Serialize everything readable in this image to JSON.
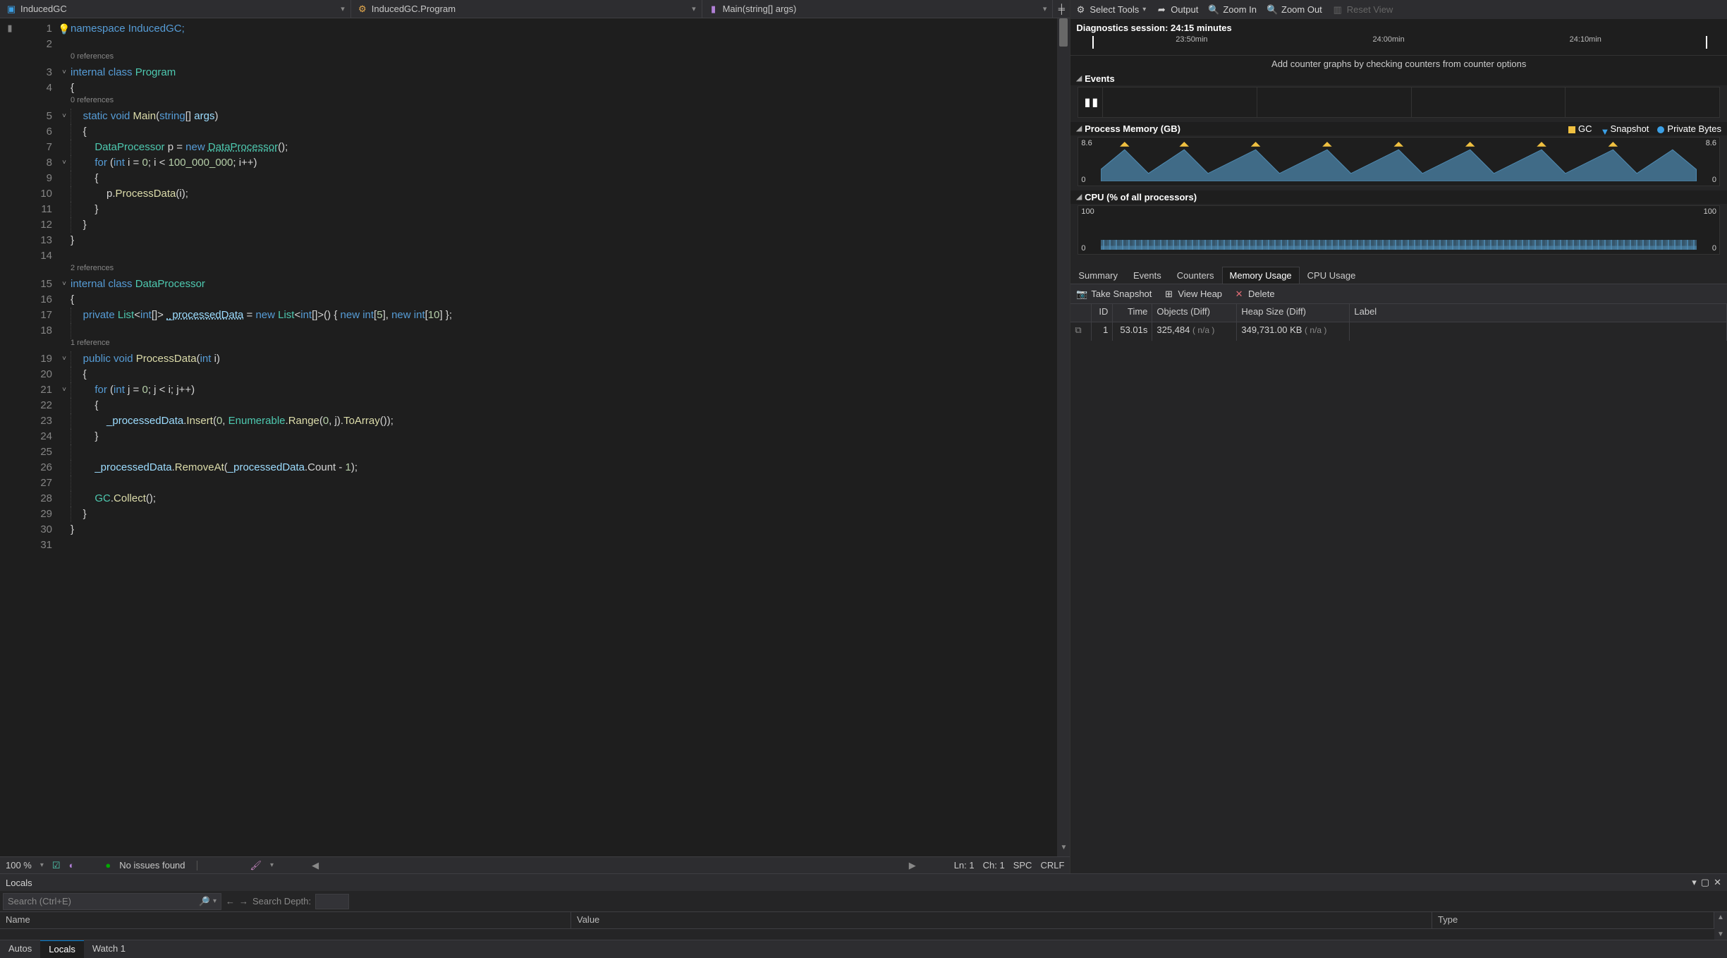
{
  "nav": {
    "project": "InducedGC",
    "class": "InducedGC.Program",
    "member": "Main(string[] args)"
  },
  "code": {
    "l1": "namespace InducedGC;",
    "ref1": "0 references",
    "l3_kw": "internal class ",
    "l3_cls": "Program",
    "ref2": "0 references",
    "l5_a": "static void ",
    "l5_m": "Main",
    "l5_b": "(",
    "l5_t": "string",
    "l5_c": "[] ",
    "l5_p": "args",
    "l5_d": ")",
    "l7_a": "DataProcessor",
    "l7_b": " p = ",
    "l7_c": "new ",
    "l7_d": "DataProcessor",
    "l7_e": "();",
    "l8_a": "for ",
    "l8_b": "(",
    "l8_c": "int",
    "l8_d": " i = ",
    "l8_e": "0",
    "l8_f": "; i < ",
    "l8_g": "100_000_000",
    "l8_h": "; i++)",
    "l10_a": "p.",
    "l10_b": "ProcessData",
    "l10_c": "(i);",
    "ref3": "2 references",
    "l15_a": "internal class ",
    "l15_b": "DataProcessor",
    "l17_a": "private ",
    "l17_b": "List",
    "l17_c": "<",
    "l17_d": "int",
    "l17_e": "[]> ",
    "l17_f": "_processedData",
    "l17_g": " = ",
    "l17_h": "new ",
    "l17_i": "List",
    "l17_j": "<",
    "l17_k": "int",
    "l17_l": "[]>() { ",
    "l17_m": "new int",
    "l17_n": "[",
    "l17_o": "5",
    "l17_p": "], ",
    "l17_q": "new int",
    "l17_r": "[",
    "l17_s": "10",
    "l17_t": "] };",
    "ref4": "1 reference",
    "l19_a": "public void ",
    "l19_b": "ProcessData",
    "l19_c": "(",
    "l19_d": "int",
    "l19_e": " i)",
    "l21_a": "for ",
    "l21_b": "(",
    "l21_c": "int",
    "l21_d": " j = ",
    "l21_e": "0",
    "l21_f": "; j < i; j++)",
    "l23_a": "_processedData",
    "l23_b": ".",
    "l23_c": "Insert",
    "l23_d": "(",
    "l23_e": "0",
    "l23_f": ", ",
    "l23_g": "Enumerable",
    "l23_h": ".",
    "l23_i": "Range",
    "l23_j": "(",
    "l23_k": "0",
    "l23_l": ", j).",
    "l23_m": "ToArray",
    "l23_n": "());",
    "l26_a": "_processedData",
    "l26_b": ".",
    "l26_c": "RemoveAt",
    "l26_d": "(",
    "l26_e": "_processedData",
    "l26_f": ".Count - ",
    "l26_g": "1",
    "l26_h": ");",
    "l28_a": "GC",
    "l28_b": ".",
    "l28_c": "Collect",
    "l28_d": "();"
  },
  "status": {
    "zoom": "100 %",
    "issues": "No issues found",
    "ln": "Ln: 1",
    "ch": "Ch: 1",
    "spc": "SPC",
    "crlf": "CRLF"
  },
  "diag": {
    "tools": "Select Tools",
    "output": "Output",
    "zi": "Zoom In",
    "zo": "Zoom Out",
    "rv": "Reset View",
    "session": "Diagnostics session: 24:15 minutes",
    "t1": "23:50min",
    "t2": "24:00min",
    "t3": "24:10min",
    "hint": "Add counter graphs by checking counters from counter options",
    "events": "Events",
    "mem_title": "Process Memory (GB)",
    "gc": "GC",
    "snap": "Snapshot",
    "pb": "Private Bytes",
    "mem_hi": "8.6",
    "mem_lo": "0",
    "cpu_title": "CPU (% of all processors)",
    "cpu_hi": "100",
    "cpu_lo": "0",
    "tabs": {
      "summary": "Summary",
      "events": "Events",
      "counters": "Counters",
      "mem": "Memory Usage",
      "cpu": "CPU Usage"
    },
    "actions": {
      "take": "Take Snapshot",
      "view": "View Heap",
      "del": "Delete"
    },
    "cols": {
      "id": "ID",
      "time": "Time",
      "obj": "Objects (Diff)",
      "heap": "Heap Size (Diff)",
      "lbl": "Label"
    },
    "row": {
      "id": "1",
      "time": "53.01s",
      "obj": "325,484",
      "obj_d": "( n/a )",
      "heap": "349,731.00 KB",
      "heap_d": "( n/a )"
    }
  },
  "bottom": {
    "title": "Locals",
    "placeholder": "Search (Ctrl+E)",
    "depth": "Search Depth:",
    "cols": {
      "name": "Name",
      "value": "Value",
      "type": "Type"
    },
    "tabs": {
      "autos": "Autos",
      "locals": "Locals",
      "watch": "Watch 1"
    }
  },
  "chart_data": {
    "process_memory": {
      "type": "area",
      "unit": "GB",
      "ylim": [
        0,
        8.6
      ],
      "samples": [
        3,
        7.0,
        2,
        6.8,
        3,
        7.2,
        2,
        7.4,
        3,
        7.0,
        2,
        7.2,
        3,
        7.1,
        2,
        7.3,
        3,
        7.0
      ],
      "gc_markers_count": 8
    },
    "cpu": {
      "type": "area",
      "unit": "%",
      "ylim": [
        0,
        100
      ],
      "approx_avg": 6
    }
  }
}
